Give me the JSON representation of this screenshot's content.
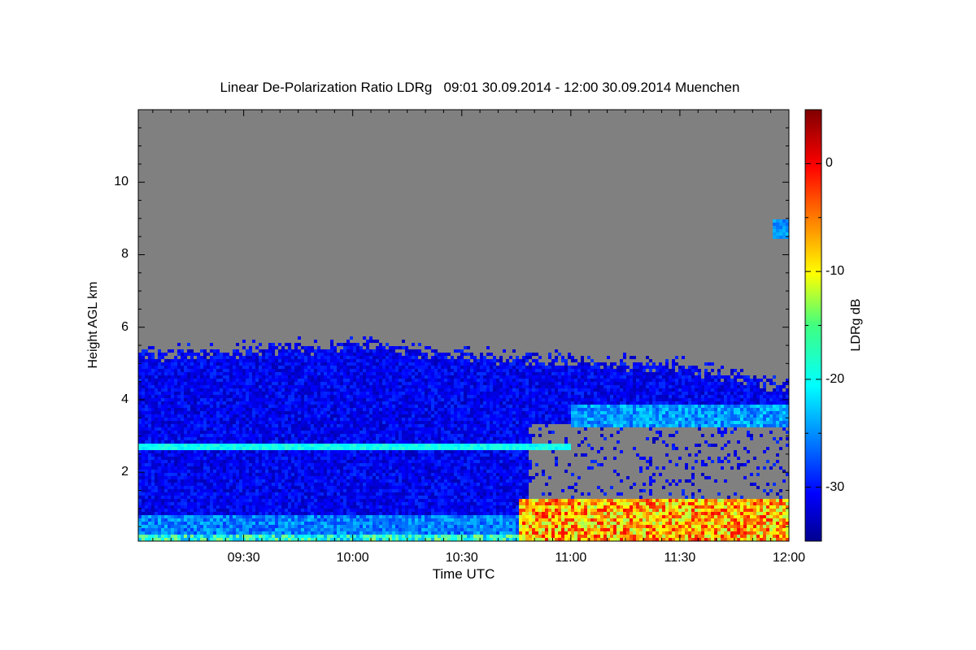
{
  "chart_data": {
    "type": "heatmap",
    "title": "Linear De-Polarization Ratio LDRg   09:01 30.09.2014 - 12:00 30.09.2014 Muenchen",
    "xlabel": "Time UTC",
    "ylabel": "Height AGL km",
    "colorbar_label": "LDRg dB",
    "x_range": [
      "09:01",
      "12:00"
    ],
    "x_ticks": [
      "09:30",
      "10:00",
      "10:30",
      "11:00",
      "11:30",
      "12:00"
    ],
    "y_range_km": [
      0.1,
      12.0
    ],
    "y_ticks": [
      "2",
      "4",
      "6",
      "8",
      "10"
    ],
    "colorbar_range_db": [
      -35,
      5
    ],
    "colorbar_ticks": [
      "0",
      "-10",
      "-20",
      "-30"
    ],
    "colorscale": "jet",
    "no_data_color": "#808080",
    "features": [
      {
        "description": "aerosol layer top",
        "start": "09:01",
        "end": "12:00",
        "height_km": [
          5.3,
          5.6,
          5.1,
          4.4
        ],
        "ldr_db": -31
      },
      {
        "description": "thin elevated layer",
        "start": "09:01",
        "end": "11:00",
        "height_km": 2.75,
        "ldr_db": -22
      },
      {
        "description": "boundary layer",
        "start": "10:45",
        "end": "12:00",
        "height_km": [
          0.1,
          1.2
        ],
        "ldr_db": -8
      },
      {
        "description": "upper cloud",
        "start": "11:55",
        "end": "12:00",
        "height_km": 8.8,
        "ldr_db": -24
      }
    ]
  }
}
